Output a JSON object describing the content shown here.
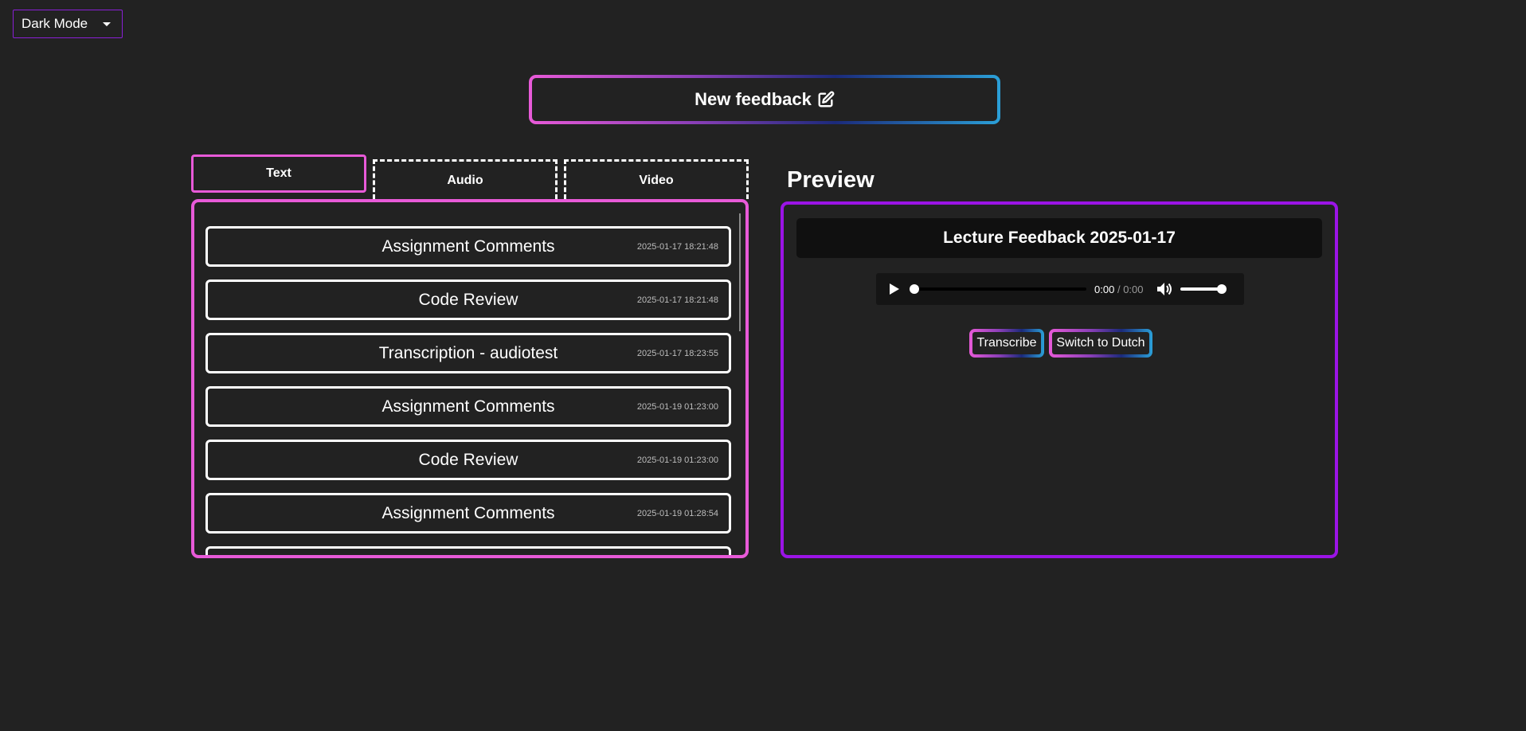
{
  "theme_select": {
    "value": "Dark Mode"
  },
  "new_feedback": {
    "label": "New feedback",
    "icon": "edit-icon"
  },
  "tabs": [
    {
      "label": "Text",
      "active": true
    },
    {
      "label": "Audio",
      "active": false
    },
    {
      "label": "Video",
      "active": false
    }
  ],
  "feedback_list": [
    {
      "title": "Assignment Comments",
      "date": "2025-01-17 18:21:48"
    },
    {
      "title": "Code Review",
      "date": "2025-01-17 18:21:48"
    },
    {
      "title": "Transcription - audiotest",
      "date": "2025-01-17 18:23:55"
    },
    {
      "title": "Assignment Comments",
      "date": "2025-01-19 01:23:00"
    },
    {
      "title": "Code Review",
      "date": "2025-01-19 01:23:00"
    },
    {
      "title": "Assignment Comments",
      "date": "2025-01-19 01:28:54"
    },
    {
      "title": "",
      "date": ""
    }
  ],
  "preview": {
    "heading": "Preview",
    "title": "Lecture Feedback 2025-01-17",
    "player": {
      "current_time": "0:00",
      "separator": "/",
      "duration": "0:00",
      "progress": 0,
      "volume": 1
    },
    "buttons": {
      "transcribe": "Transcribe",
      "switch_language": "Switch to Dutch"
    }
  },
  "colors": {
    "background": "#222222",
    "pink_accent": "#e85ad8",
    "purple_accent": "#9b14e6",
    "blue_accent": "#2ba0d8"
  }
}
